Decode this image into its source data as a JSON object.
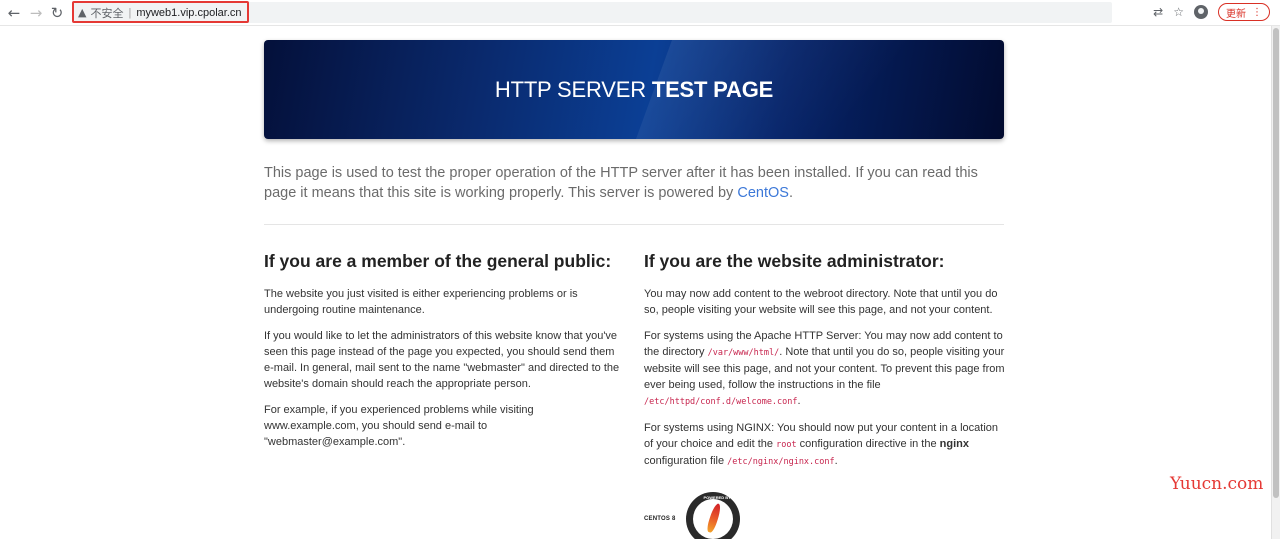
{
  "browser": {
    "security_label": "不安全",
    "separator": "|",
    "url": "myweb1.vip.cpolar.cn",
    "update_label": "更新",
    "menu_glyph": "⋮",
    "icons": [
      "back-arrow-icon",
      "forward-arrow-icon",
      "reload-icon",
      "warning-icon",
      "translate-icon",
      "star-icon",
      "profile-icon"
    ]
  },
  "banner": {
    "title_light": "HTTP SERVER ",
    "title_bold": "TEST PAGE"
  },
  "intro": {
    "text_before": "This page is used to test the proper operation of the HTTP server after it has been installed. If you can read this page it means that this site is working properly. This server is powered by ",
    "link": "CentOS",
    "text_after": "."
  },
  "public": {
    "heading": "If you are a member of the general public:",
    "p1": "The website you just visited is either experiencing problems or is undergoing routine maintenance.",
    "p2": "If you would like to let the administrators of this website know that you've seen this page instead of the page you expected, you should send them e-mail. In general, mail sent to the name \"webmaster\" and directed to the website's domain should reach the appropriate person.",
    "p3": "For example, if you experienced problems while visiting www.example.com, you should send e-mail to \"webmaster@example.com\"."
  },
  "admin": {
    "heading": "If you are the website administrator:",
    "p1": "You may now add content to the webroot directory. Note that until you do so, people visiting your website will see this page, and not your content.",
    "p2_a": "For systems using the Apache HTTP Server: You may now add content to the directory ",
    "p2_code1": "/var/www/html/",
    "p2_b": ". Note that until you do so, people visiting your website will see this page, and not your content. To prevent this page from ever being used, follow the instructions in the file ",
    "p2_code2": "/etc/httpd/conf.d/welcome.conf",
    "p2_c": ".",
    "p3_a": "For systems using NGINX: You should now put your content in a location of your choice and edit the ",
    "p3_code1": "root",
    "p3_b": " configuration directive in the ",
    "p3_bold": "nginx",
    "p3_c": " configuration file ",
    "p3_code2": "/etc/nginx/nginx.conf",
    "p3_d": "."
  },
  "badges": {
    "centos": "CENTOS 8",
    "apache_ring": "POWERED BY"
  },
  "watermark": "Yuucn.com"
}
